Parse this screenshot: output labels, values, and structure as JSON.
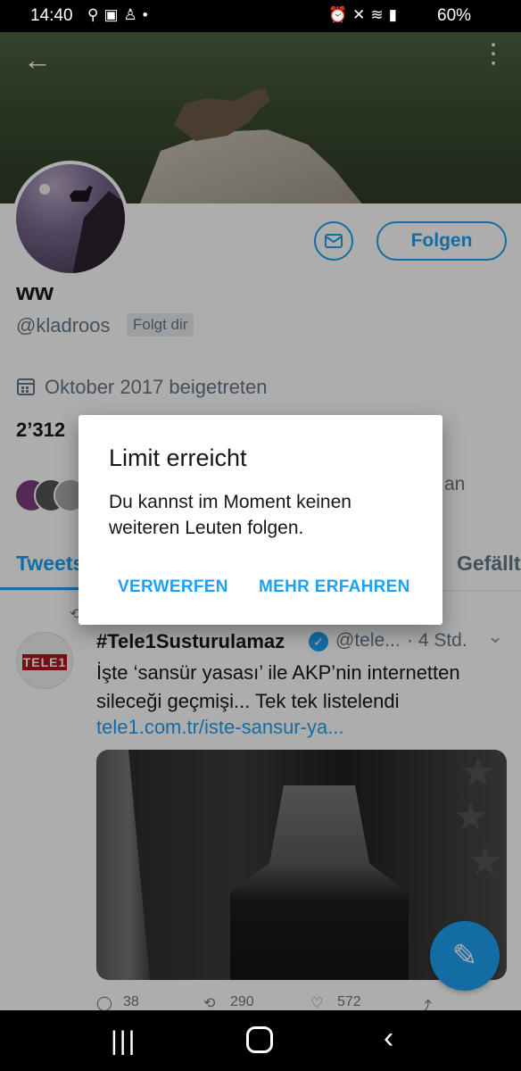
{
  "status_bar": {
    "time": "14:40",
    "left_icons": [
      "usb-icon",
      "image-icon",
      "add-person-icon",
      "dot-icon"
    ],
    "right_icons": [
      "alarm-icon",
      "mute-icon",
      "wifi-icon",
      "signal-icon"
    ],
    "battery": "60%"
  },
  "profile": {
    "display_name": "ww",
    "handle": "@kladroos",
    "follows_you_badge": "Folgt dir",
    "joined": "Oktober 2017 beigetreten",
    "following_count": "2’312",
    "followed_by_tail": "an",
    "follow_button": "Folgen"
  },
  "tabs": {
    "tweets": "Tweets",
    "likes": "Gefällt"
  },
  "tweet": {
    "author": "#Tele1Susturulamaz",
    "handle": "@tele...",
    "time": "· 4 Std.",
    "avatar_logo": "TELE1",
    "text": "İşte ‘sansür yasası’ ile AKP’nin internetten sileceği geçmişi... Tek tek listelendi",
    "link": "tele1.com.tr/iste-sansur-ya...",
    "replies": "38",
    "retweets": "290",
    "likes": "572"
  },
  "dialog": {
    "title": "Limit erreicht",
    "message": "Du kannst im Moment keinen weiteren Leuten folgen.",
    "dismiss": "VERWERFEN",
    "learn_more": "MEHR ERFAHREN"
  },
  "colors": {
    "accent": "#1da1f2",
    "secondary_text": "#657786"
  }
}
